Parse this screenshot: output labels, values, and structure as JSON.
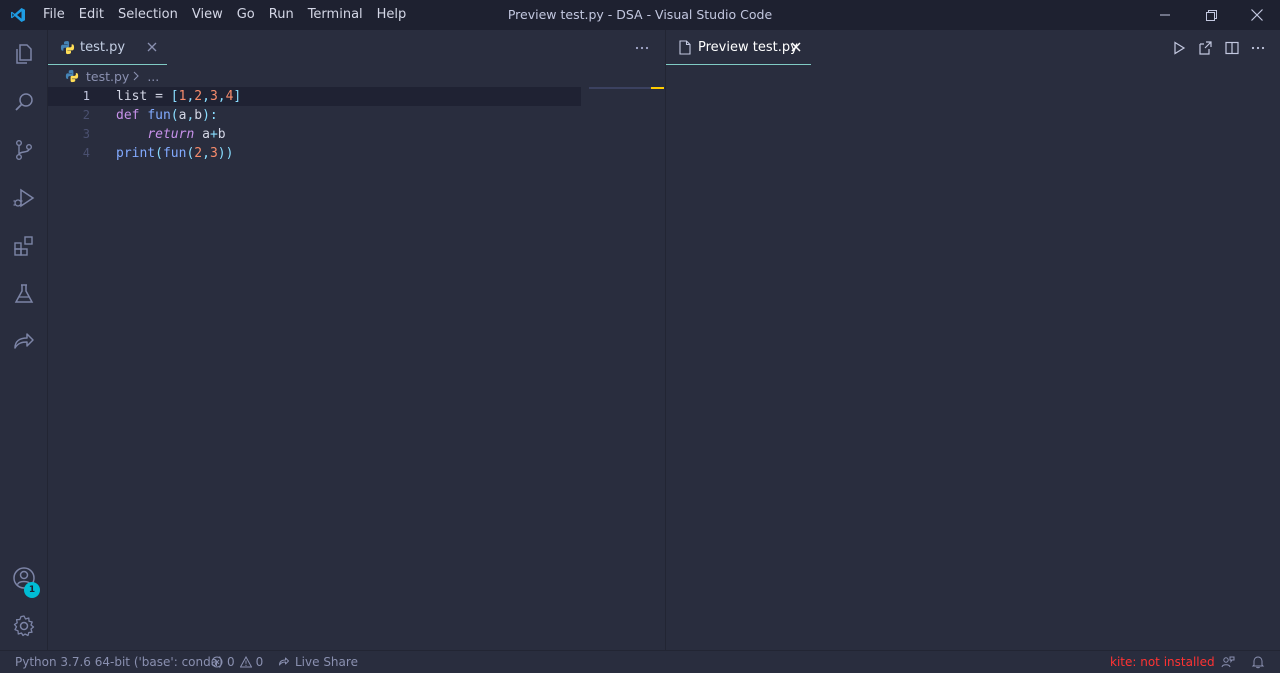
{
  "window": {
    "title": "Preview test.py - DSA - Visual Studio Code",
    "menu": [
      "File",
      "Edit",
      "Selection",
      "View",
      "Go",
      "Run",
      "Terminal",
      "Help"
    ]
  },
  "activity_bar": {
    "items": [
      "explorer-icon",
      "search-icon",
      "source-control-icon",
      "run-debug-icon",
      "extensions-icon",
      "testing-flask-icon",
      "live-share-icon"
    ],
    "accounts_badge": "1"
  },
  "editor_left": {
    "tab_label": "test.py",
    "breadcrumb": {
      "file": "test.py",
      "more": "..."
    },
    "lines": [
      {
        "number": "1",
        "tokens": [
          [
            "id",
            "list = "
          ],
          [
            "pun",
            "["
          ],
          [
            "num",
            "1"
          ],
          [
            "pun",
            ","
          ],
          [
            "num",
            "2"
          ],
          [
            "pun",
            ","
          ],
          [
            "num",
            "3"
          ],
          [
            "pun",
            ","
          ],
          [
            "num",
            "4"
          ],
          [
            "pun",
            "]"
          ]
        ]
      },
      {
        "number": "2",
        "tokens": [
          [
            "kw",
            "def "
          ],
          [
            "fn",
            "fun"
          ],
          [
            "pun",
            "("
          ],
          [
            "id",
            "a"
          ],
          [
            "pun",
            ","
          ],
          [
            "id",
            "b"
          ],
          [
            "pun",
            "):"
          ]
        ]
      },
      {
        "number": "3",
        "tokens": [
          [
            "id",
            "    "
          ],
          [
            "it",
            "return"
          ],
          [
            "id",
            " a"
          ],
          [
            "pun",
            "+"
          ],
          [
            "id",
            "b"
          ]
        ]
      },
      {
        "number": "4",
        "tokens": [
          [
            "fn",
            "print"
          ],
          [
            "pun",
            "("
          ],
          [
            "fn",
            "fun"
          ],
          [
            "pun",
            "("
          ],
          [
            "num",
            "2"
          ],
          [
            "pun",
            ","
          ],
          [
            "num",
            "3"
          ],
          [
            "pun",
            "))"
          ]
        ]
      }
    ]
  },
  "editor_right": {
    "tab_label": "Preview test.py"
  },
  "statusbar": {
    "interpreter": "Python 3.7.6 64-bit ('base': conda)",
    "errors": "0",
    "warnings": "0",
    "live_share": "Live Share",
    "kite": "kite: not installed"
  },
  "colors": {
    "background": "#292d3e",
    "accent": "#80cbc4",
    "badge": "#00bcd4",
    "kite_error": "#ff3333"
  }
}
